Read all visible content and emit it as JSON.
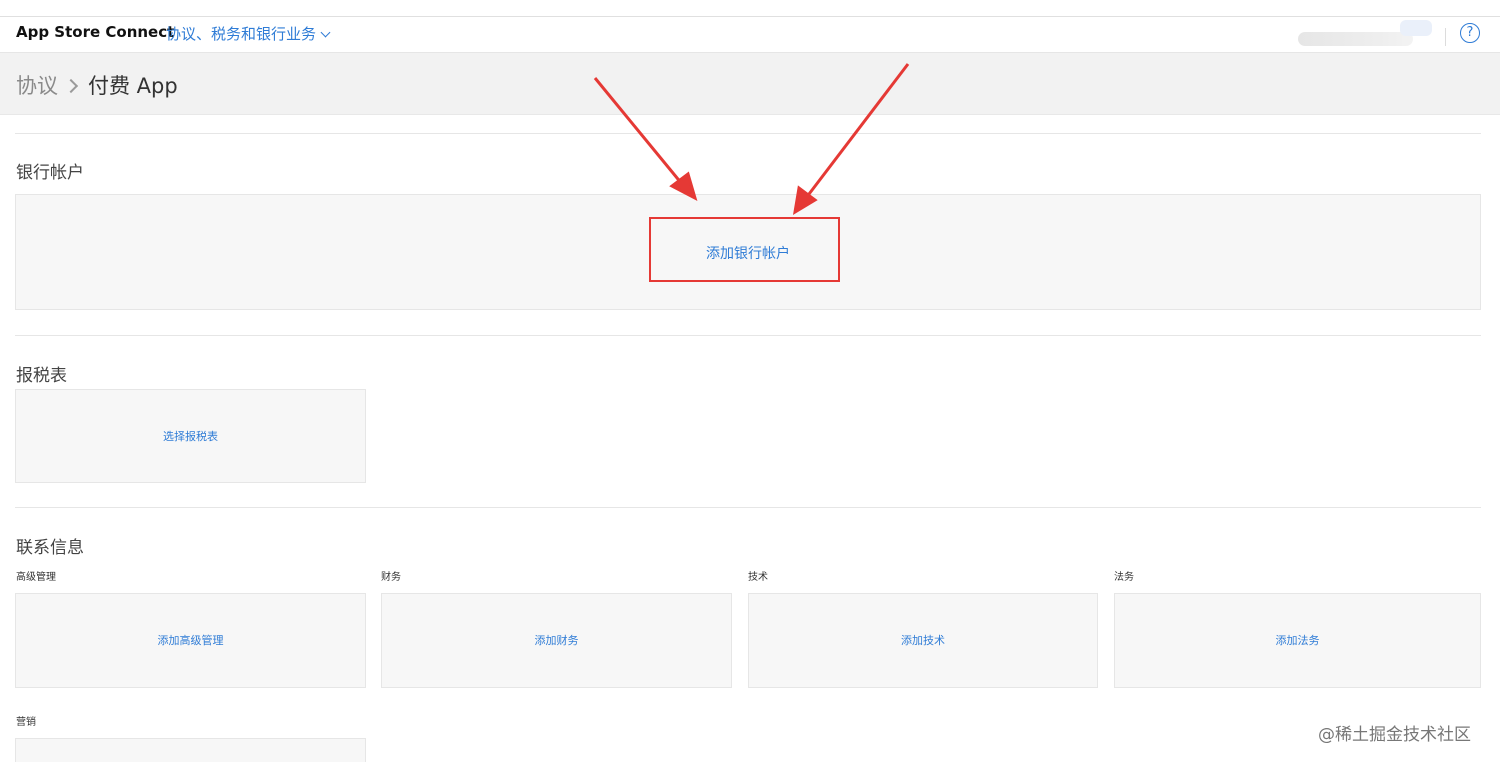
{
  "topbar": {
    "brand": "App Store Connect",
    "section_menu": "协议、税务和银行业务",
    "help_glyph": "?"
  },
  "breadcrumb": {
    "parent": "协议",
    "current": "付费 App"
  },
  "bank": {
    "title": "银行帐户",
    "add_link": "添加银行帐户"
  },
  "tax": {
    "title": "报税表",
    "select_link": "选择报税表"
  },
  "contacts": {
    "title": "联系信息",
    "groups": [
      {
        "label": "高级管理",
        "link": "添加高级管理"
      },
      {
        "label": "财务",
        "link": "添加财务"
      },
      {
        "label": "技术",
        "link": "添加技术"
      },
      {
        "label": "法务",
        "link": "添加法务"
      },
      {
        "label": "营销"
      }
    ]
  },
  "watermark": "@稀土掘金技术社区",
  "colors": {
    "link": "#2f7cd6",
    "annotation": "#e53935"
  }
}
